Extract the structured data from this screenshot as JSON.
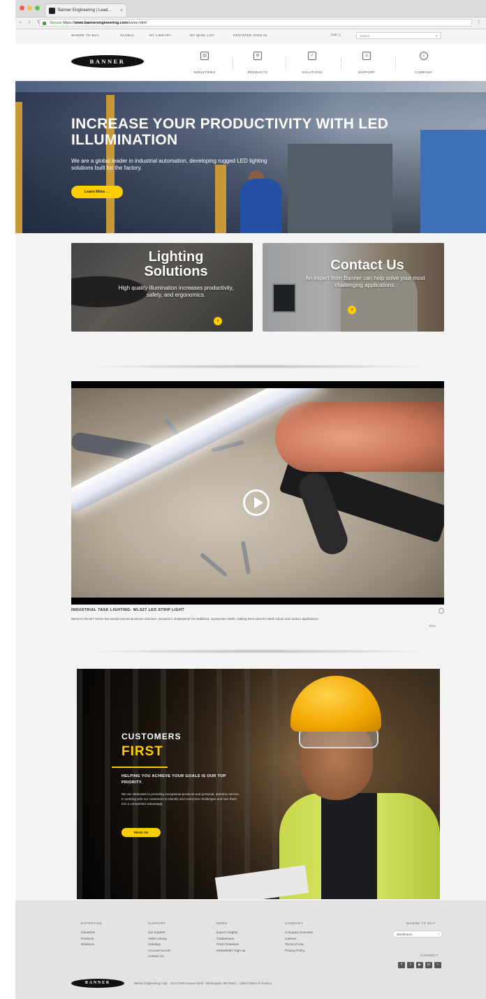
{
  "browser": {
    "tab_title": "Banner Engineering | Lead...",
    "secure_label": "Secure",
    "url_scheme": "https://",
    "url_host": "www.bannerengineering.com",
    "url_path": "/us/en.html"
  },
  "utility_nav": {
    "links": [
      "Where to Buy",
      "Global",
      "My Library",
      "My Wish List",
      "Register Sign In"
    ],
    "cart_label": "Cart",
    "search_placeholder": "Search"
  },
  "logo_text": "BANNER",
  "main_nav": [
    {
      "label": "Industries",
      "icon": "building-icon"
    },
    {
      "label": "Products",
      "icon": "gear-icon"
    },
    {
      "label": "Solutions",
      "icon": "check-icon"
    },
    {
      "label": "Support",
      "icon": "person-icon"
    },
    {
      "label": "Company",
      "icon": "info-icon"
    }
  ],
  "hero": {
    "title": "Increase your productivity with LED illumination",
    "text": "We are a global leader in industrial automation, developing rugged LED lighting solutions built for the factory.",
    "button": "Learn More →"
  },
  "cards": [
    {
      "title_line1": "Lighting",
      "title_line2": "Solutions",
      "desc": "High quality illumination increases productivity, safety, and ergonomics."
    },
    {
      "title_line1": "Contact Us",
      "title_line2": "",
      "desc": "An expert from Banner can help solve your most challenging applications."
    }
  ],
  "video": {
    "title": "Industrial Task Lighting: WLS27 LED Strip Light",
    "caption": "Banner's WLS27 Series has sturdy internal aluminum structure, encased in shatterproof UV-stabilized, copolyester shells, making them ideal for harsh indoor and outdoor applications.",
    "more": "More"
  },
  "customers_first": {
    "eyebrow": "Customers",
    "headline": "First",
    "subhead": "Helping you achieve your goals is our top priority.",
    "body": "We are dedicated to providing exceptional products and personal, attentive service. In working with our customers to identify and overcome challenges and turn them into a competitive advantage.",
    "button": "Read On"
  },
  "footer": {
    "columns": [
      {
        "heading": "Expertise",
        "links": [
          "Industries",
          "Products",
          "Solutions"
        ]
      },
      {
        "heading": "Support",
        "links": [
          "Our Experts",
          "Video Library",
          "Catalogs",
          "Account Access",
          "Contact Us"
        ]
      },
      {
        "heading": "News",
        "links": [
          "Expert Insights",
          "Tradeshows",
          "Press Releases",
          "eNewsletter Sign-up"
        ]
      },
      {
        "heading": "Company",
        "links": [
          "Company Overview",
          "Careers",
          "Terms of Use",
          "Privacy Policy"
        ]
      }
    ],
    "where_to_buy_title": "Where to Buy",
    "where_to_buy_select": "Distributors",
    "connect_title": "Connect",
    "socials": [
      "facebook-icon",
      "twitter-icon",
      "youtube-icon",
      "linkedin-icon",
      "video-icon"
    ],
    "address": "Banner Engineering Corp. · 9714 Tenth Avenue North · Minneapolis, MN 55441 · United States of America"
  },
  "colors": {
    "brand_yellow": "#ffcd00",
    "logo_black": "#111111",
    "footer_bg": "#e3e3e3"
  }
}
